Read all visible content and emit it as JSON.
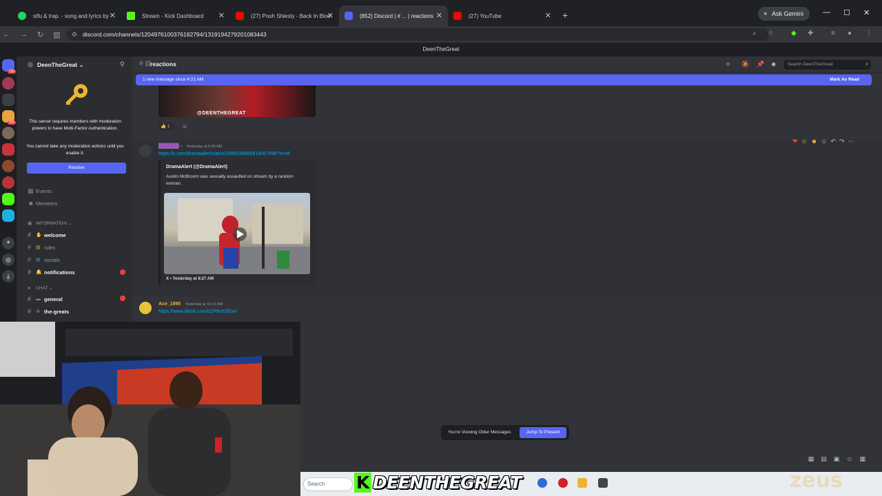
{
  "browser": {
    "tabs": [
      {
        "title": "stfu & trap. - song and lyrics by",
        "color": "#1ed760"
      },
      {
        "title": "Stream - Kick Dashboard",
        "color": "#53fc18"
      },
      {
        "title": "(27) Pooh Shiesty - Back In Bloo",
        "color": "#ff0000"
      },
      {
        "title": "(852) Discord | # ... | reactions",
        "color": "#5865f2",
        "active": true
      },
      {
        "title": "(27) YouTube",
        "color": "#ff0000"
      }
    ],
    "new_tab": "+",
    "ask_gemini": "Ask Gemini",
    "url": "discord.com/channels/1204976100376182794/1319194279201083443"
  },
  "discord": {
    "window_title": "DeenTheGreat",
    "server_name": "DeenTheGreat",
    "mfa": {
      "line1": "This server requires members with moderation powers to have Multi-Factor Authentication.",
      "line2": "You cannot take any moderation actions until you enable it.",
      "button": "Resolve"
    },
    "nav": {
      "events": "Events",
      "members": "Members"
    },
    "category_info": "INFORMATION",
    "category_chat": "CHAT",
    "channels": [
      {
        "name": "welcome",
        "bold": true
      },
      {
        "name": "rules",
        "bold": false
      },
      {
        "name": "socials",
        "bold": false
      },
      {
        "name": "notifications",
        "bold": true
      },
      {
        "name": "general",
        "bold": true
      },
      {
        "name": "the-greats",
        "bold": true
      }
    ],
    "channel_header": "reactions",
    "search_placeholder": "Search DeenTheGreat",
    "new_messages_banner": "1 new message since 4:21 AM",
    "mark_as_read": "Mark As Read",
    "image_caption": "@DEENTHEGREAT",
    "reaction_count": "1",
    "message1": {
      "timestamp": "Yesterday at 6:46 AM",
      "link": "https://x.com/dramaalert/status/2085039965814067996?s=46",
      "embed_author": "DramaAlert (@DramaAlert)",
      "embed_desc": "Austin McBroom was sexually assaulted on stream by a random woman.",
      "embed_footer": "X • Yesterday at 8:27 AM"
    },
    "message2": {
      "author": "Ace_1990",
      "timestamp": "Yesterday at 10:10 AM",
      "link": "https://www.tiktok.com/t/ZP8nh2fGw/"
    },
    "viewing_older": "You're Viewing Older Messages",
    "jump_to_present": "Jump To Present"
  },
  "taskbar": {
    "search": "Search",
    "streamer_tag": "DEENTHEGREAT",
    "watermark": "zeus"
  }
}
